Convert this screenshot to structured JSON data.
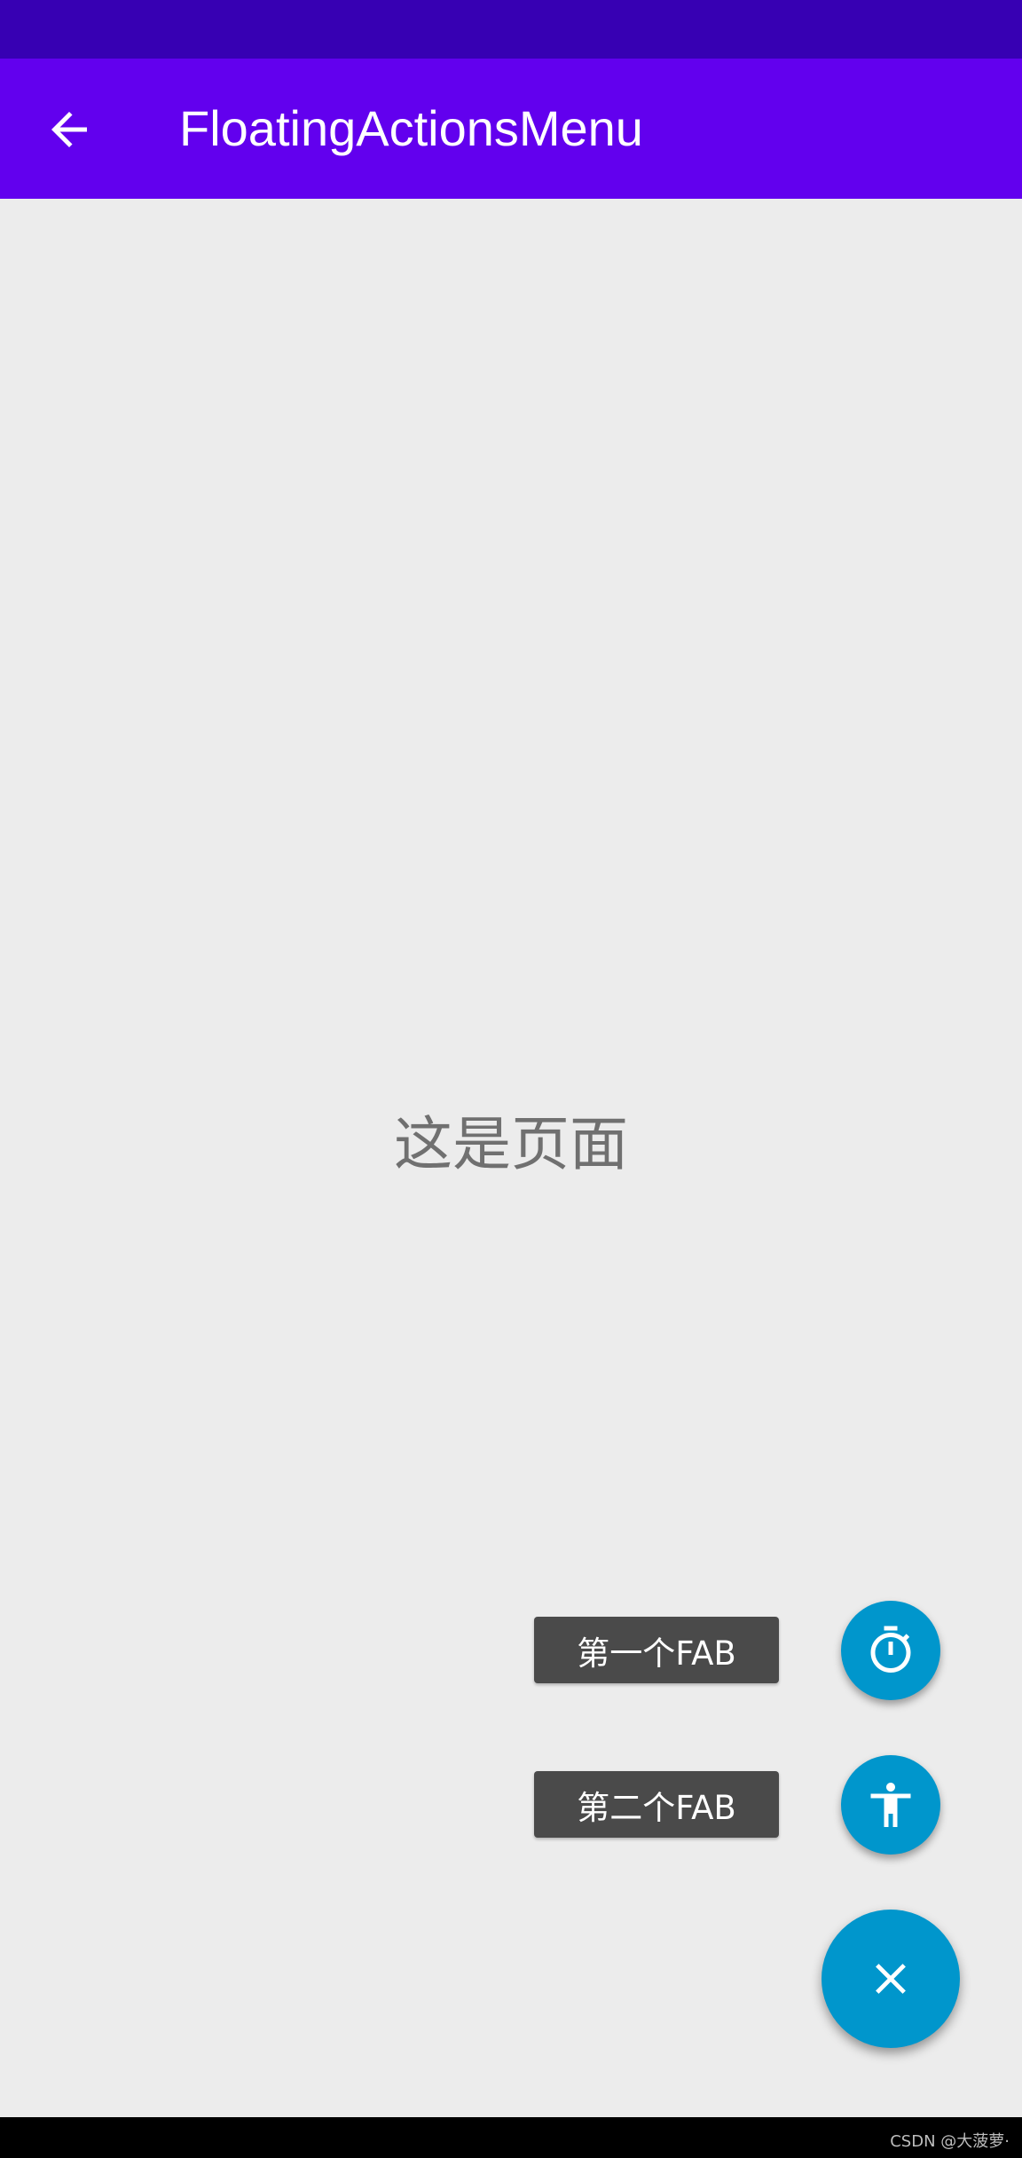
{
  "app_bar": {
    "title": "FloatingActionsMenu",
    "back_icon": "arrow-back-icon",
    "background": "#6200ee"
  },
  "status_bar": {
    "background": "#3700b3"
  },
  "page": {
    "text": "这是页面",
    "background": "#ececec"
  },
  "fab_menu": {
    "items": [
      {
        "label": "第一个FAB",
        "icon": "timer-icon"
      },
      {
        "label": "第二个FAB",
        "icon": "accessibility-icon"
      }
    ],
    "main_icon": "close-icon",
    "accent": "#0096cc"
  },
  "watermark": "CSDN @大菠萝·"
}
